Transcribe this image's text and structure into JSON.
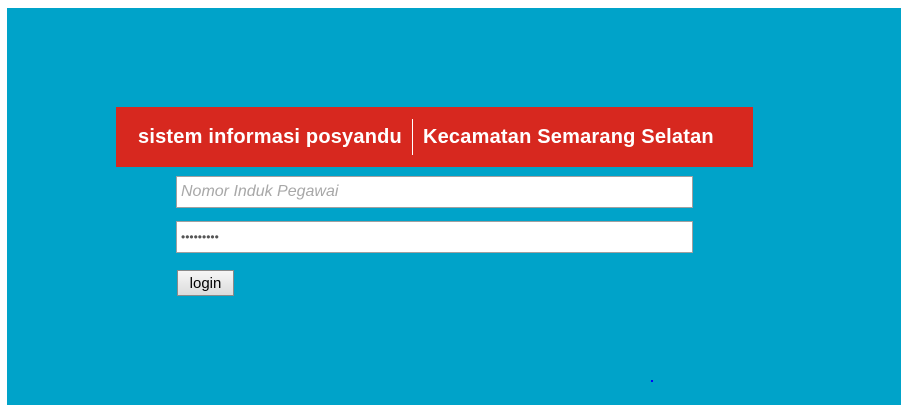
{
  "banner": {
    "app_name": "sistem informasi posyandu",
    "region": "Kecamatan Semarang Selatan"
  },
  "form": {
    "nip_placeholder": "Nomor Induk Pegawai",
    "nip_value": "",
    "password_value": "•••••••••",
    "login_label": "login"
  },
  "colors": {
    "page_background": "#00a3c9",
    "banner_background": "#d7281f",
    "banner_text": "#ffffff"
  }
}
